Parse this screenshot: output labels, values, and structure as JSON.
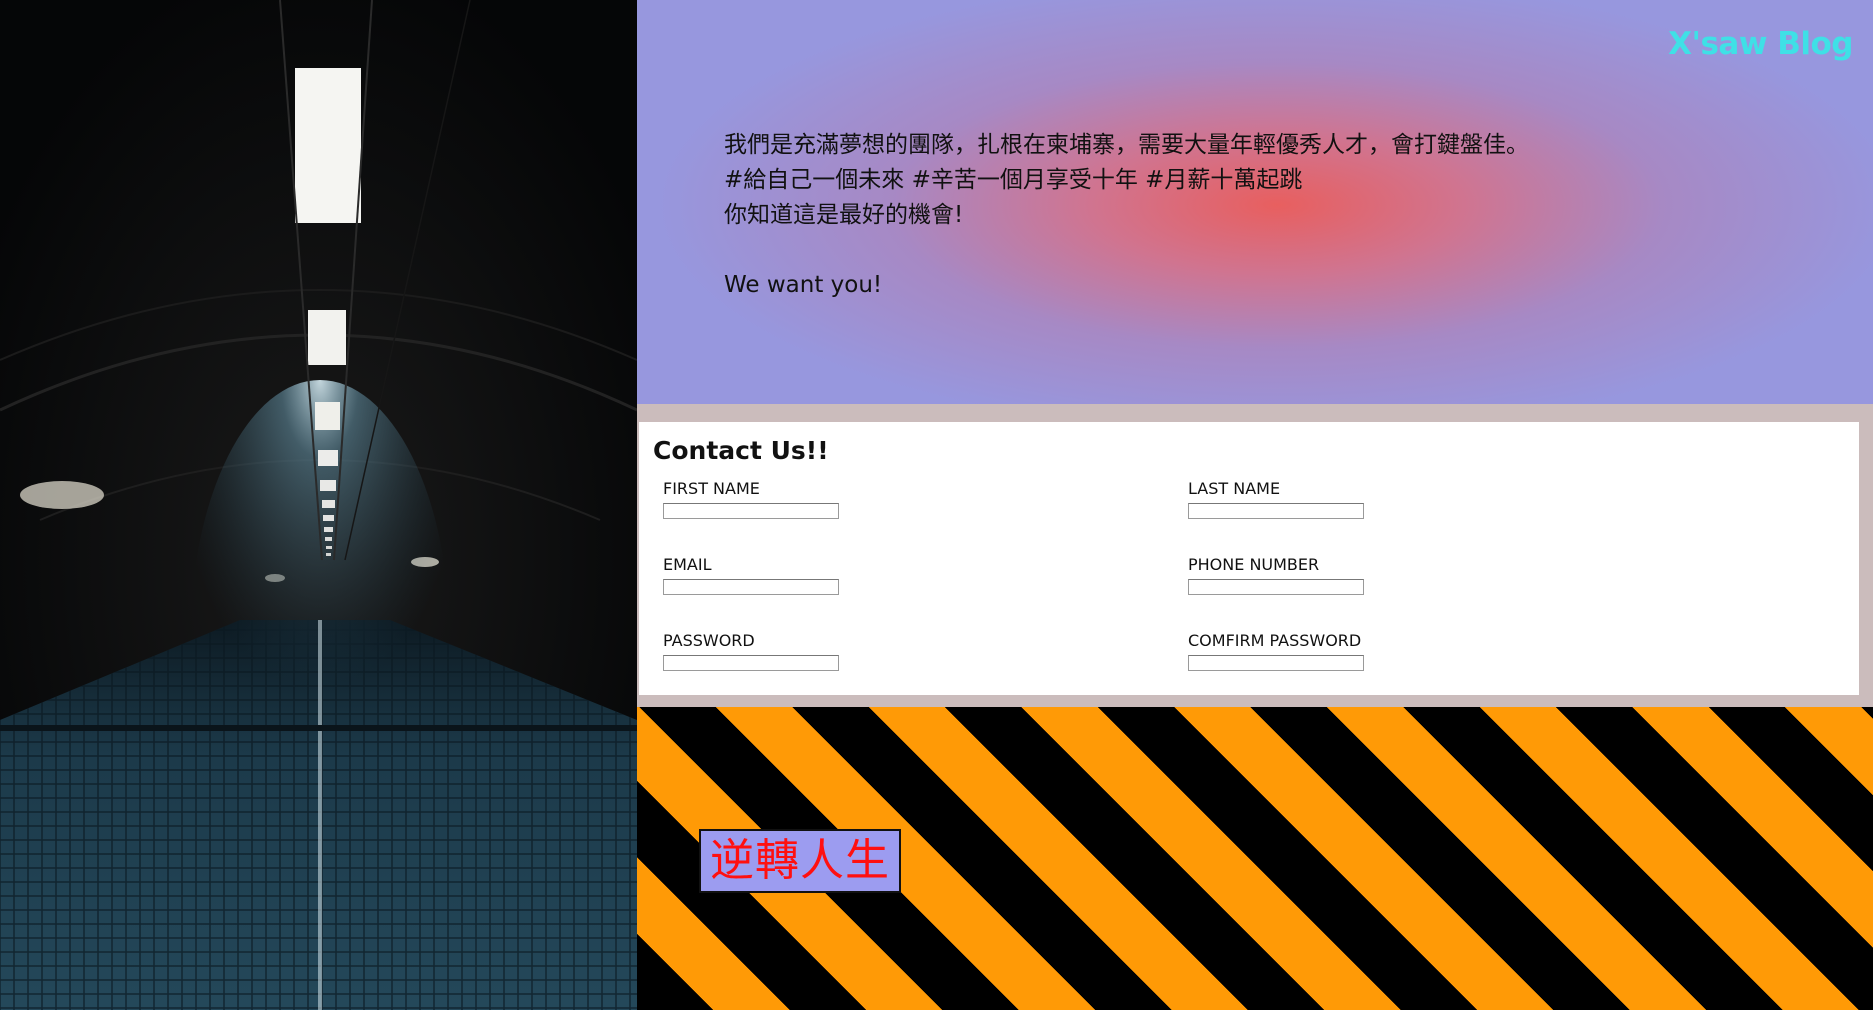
{
  "brand": "X'saw Blog",
  "intro": {
    "lines": [
      "我們是充滿夢想的團隊，扎根在柬埔寨，需要大量年輕優秀人才，會打鍵盤佳。",
      "#給自己一個未來 #辛苦一個月享受十年 #月薪十萬起跳",
      "你知道這是最好的機會!"
    ],
    "tagline": "We want you!"
  },
  "contact": {
    "title": "Contact Us!!",
    "fields": {
      "first_name": {
        "label": "FIRST NAME",
        "value": ""
      },
      "last_name": {
        "label": "LAST NAME",
        "value": ""
      },
      "email": {
        "label": "EMAIL",
        "value": ""
      },
      "phone": {
        "label": "PHONE NUMBER",
        "value": ""
      },
      "password": {
        "label": "PASSWORD",
        "value": ""
      },
      "confirm_password": {
        "label": "COMFIRM PASSWORD",
        "value": ""
      }
    }
  },
  "cta": {
    "label": "逆轉人生"
  },
  "colors": {
    "brand": "#3fe0e6",
    "hero_base": "#9797de",
    "hero_center": "#e85f5f",
    "stripe_dark": "#000000",
    "stripe_light": "#ff9a06",
    "cta_bg": "#9c9cf0",
    "cta_text": "#ff1010"
  },
  "images": {
    "hero_photo": "dark-tunnel-with-ceiling-lights"
  }
}
